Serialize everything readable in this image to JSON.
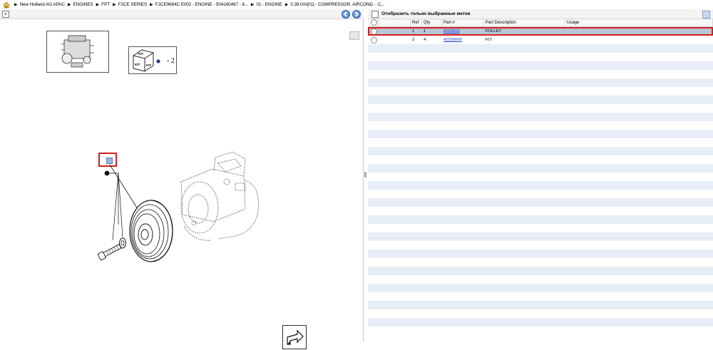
{
  "breadcrumb": {
    "items": [
      "New Holland AG APAC",
      "ENGINES",
      "FPT",
      "F2CE SERIES",
      "F2CE9684C E002 - ENGINE - 504160467 - 8...",
      "01 - ENGINE",
      "0.39.0/A[01] - COMPRESSOR, AIRCOND. - C..."
    ]
  },
  "icons": {
    "home": "home-icon",
    "expand": "expand-icon",
    "prev": "prev-arrow-icon",
    "next": "next-arrow-icon",
    "export": "export-arrow-icon"
  },
  "drawing": {
    "kit_label": "KIT",
    "kit_count": "- 2"
  },
  "filter": {
    "label": "Отобразить только выбранные метки",
    "checked": false
  },
  "table": {
    "columns": [
      "",
      "",
      "Ref",
      "Qty",
      "Part #",
      "Part Description",
      "Usage"
    ],
    "rows": [
      {
        "ref": "1",
        "qty": "1",
        "part": "8093818",
        "description": "PULLEY",
        "usage": "",
        "selected": true
      },
      {
        "ref": "2",
        "qty": "4",
        "part": "42535660",
        "description": "KIT",
        "usage": "",
        "selected": false
      }
    ]
  },
  "colors": {
    "highlight": "#d21f1f",
    "selected_row": "#b9c6d6",
    "alt_row": "#e8eef7",
    "link": "#1a39d6"
  }
}
